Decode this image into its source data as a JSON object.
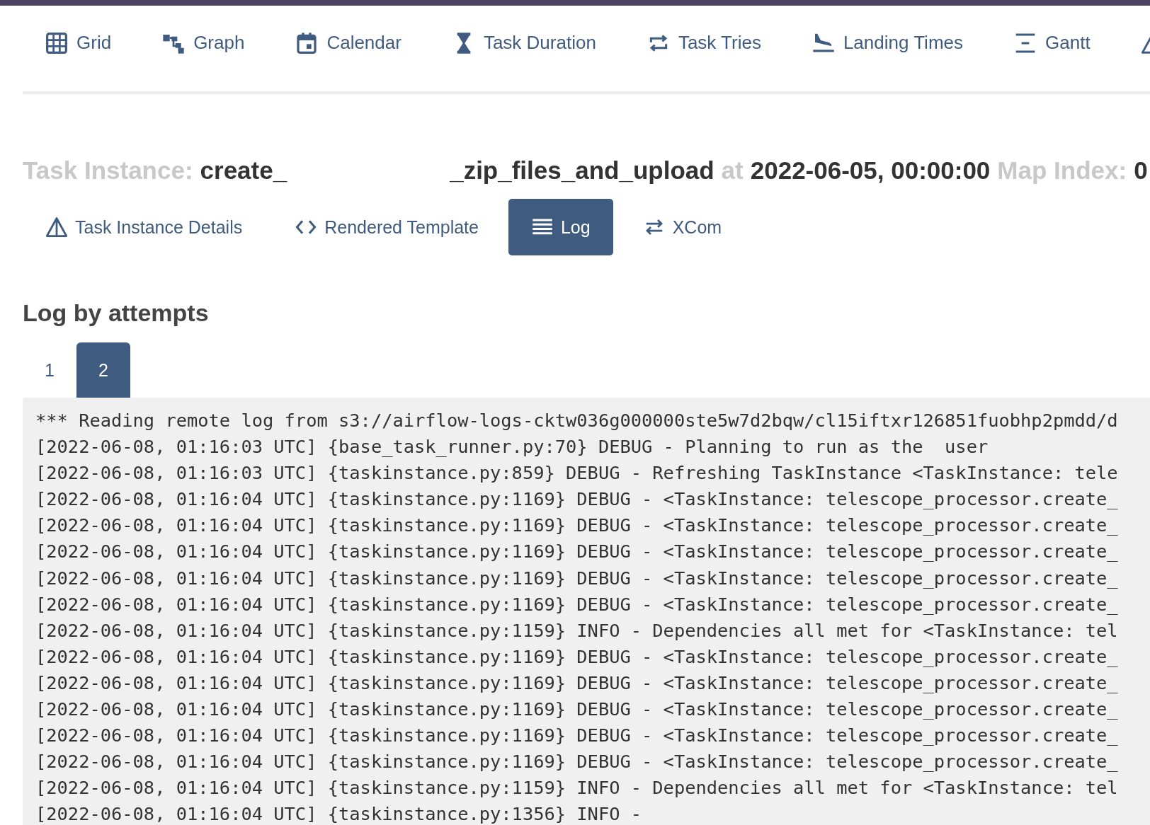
{
  "nav": [
    {
      "kind": "grid",
      "label": "Grid"
    },
    {
      "kind": "graph",
      "label": "Graph"
    },
    {
      "kind": "calendar",
      "label": "Calendar"
    },
    {
      "kind": "hourglass",
      "label": "Task Duration"
    },
    {
      "kind": "repeat",
      "label": "Task Tries"
    },
    {
      "kind": "landing",
      "label": "Landing Times"
    },
    {
      "kind": "gantt",
      "label": "Gantt"
    },
    {
      "kind": "triangle"
    }
  ],
  "title": {
    "label": "Task Instance:",
    "task_start": "create_",
    "task_end": "_zip_files_and_upload",
    "at": "at",
    "date": "2022-06-05, 00:00:00",
    "map_label": "Map Index:",
    "map_index": "0"
  },
  "tabs": [
    {
      "kind": "triangle",
      "label": "Task Instance Details",
      "selected": false
    },
    {
      "kind": "code",
      "label": "Rendered Template",
      "selected": false
    },
    {
      "kind": "lines",
      "label": "Log",
      "selected": true
    },
    {
      "kind": "swap",
      "label": "XCom",
      "selected": false
    }
  ],
  "log_heading": "Log by attempts",
  "attempts": [
    {
      "label": "1",
      "selected": false
    },
    {
      "label": "2",
      "selected": true
    }
  ],
  "log_lines": [
    "*** Reading remote log from s3://airflow-logs-cktw036g000000ste5w7d2bqw/cl15iftxr126851fuobhp2pmdd/d",
    "[2022-06-08, 01:16:03 UTC] {base_task_runner.py:70} DEBUG - Planning to run as the  user",
    "[2022-06-08, 01:16:03 UTC] {taskinstance.py:859} DEBUG - Refreshing TaskInstance <TaskInstance: tele",
    "[2022-06-08, 01:16:04 UTC] {taskinstance.py:1169} DEBUG - <TaskInstance: telescope_processor.create_",
    "[2022-06-08, 01:16:04 UTC] {taskinstance.py:1169} DEBUG - <TaskInstance: telescope_processor.create_",
    "[2022-06-08, 01:16:04 UTC] {taskinstance.py:1169} DEBUG - <TaskInstance: telescope_processor.create_",
    "[2022-06-08, 01:16:04 UTC] {taskinstance.py:1169} DEBUG - <TaskInstance: telescope_processor.create_",
    "[2022-06-08, 01:16:04 UTC] {taskinstance.py:1169} DEBUG - <TaskInstance: telescope_processor.create_",
    "[2022-06-08, 01:16:04 UTC] {taskinstance.py:1159} INFO - Dependencies all met for <TaskInstance: tel",
    "[2022-06-08, 01:16:04 UTC] {taskinstance.py:1169} DEBUG - <TaskInstance: telescope_processor.create_",
    "[2022-06-08, 01:16:04 UTC] {taskinstance.py:1169} DEBUG - <TaskInstance: telescope_processor.create_",
    "[2022-06-08, 01:16:04 UTC] {taskinstance.py:1169} DEBUG - <TaskInstance: telescope_processor.create_",
    "[2022-06-08, 01:16:04 UTC] {taskinstance.py:1169} DEBUG - <TaskInstance: telescope_processor.create_",
    "[2022-06-08, 01:16:04 UTC] {taskinstance.py:1169} DEBUG - <TaskInstance: telescope_processor.create_",
    "[2022-06-08, 01:16:04 UTC] {taskinstance.py:1159} INFO - Dependencies all met for <TaskInstance: tel",
    "[2022-06-08, 01:16:04 UTC] {taskinstance.py:1356} INFO -"
  ]
}
